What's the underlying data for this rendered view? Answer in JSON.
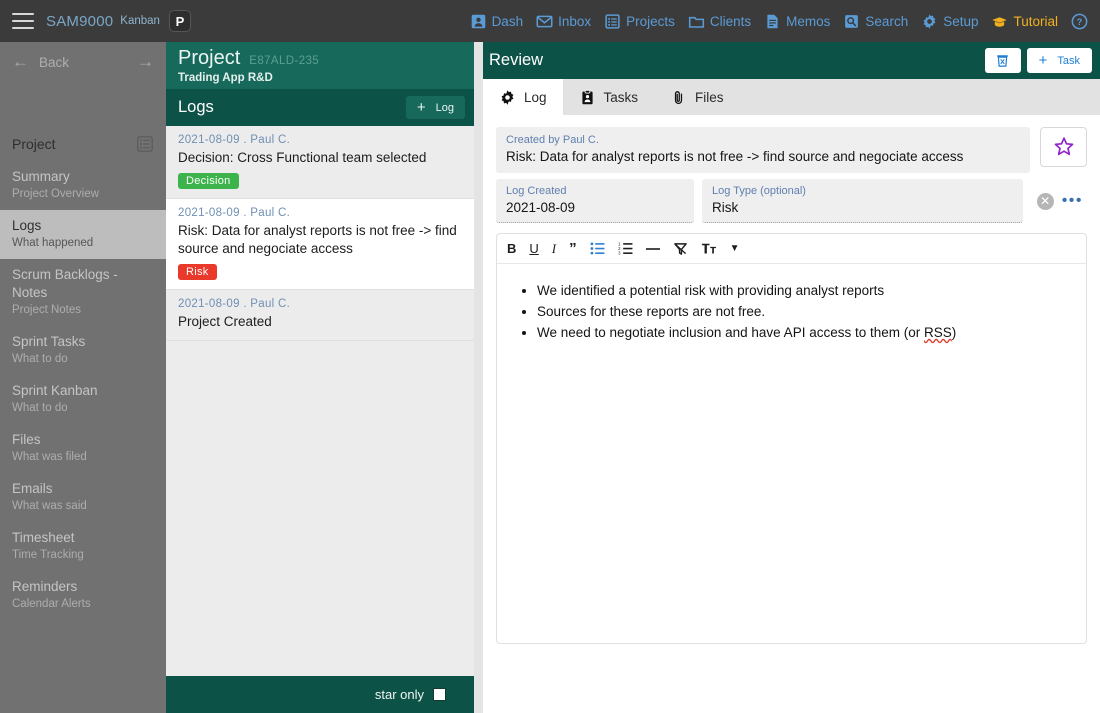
{
  "topbar": {
    "menu_icon": "hamburger-icon",
    "brand": "SAM9000",
    "brand_sub": "Kanban",
    "badge": "P",
    "nav": [
      {
        "label": "Dash",
        "icon": "user-card-icon"
      },
      {
        "label": "Inbox",
        "icon": "envelope-icon"
      },
      {
        "label": "Projects",
        "icon": "list-card-icon"
      },
      {
        "label": "Clients",
        "icon": "folder-icon"
      },
      {
        "label": "Memos",
        "icon": "document-icon"
      },
      {
        "label": "Search",
        "icon": "search-icon"
      },
      {
        "label": "Setup",
        "icon": "gear-icon"
      },
      {
        "label": "Tutorial",
        "icon": "graduation-cap-icon"
      }
    ],
    "help_icon": "question-circle-icon",
    "accent_blue": "#5b9bd5",
    "accent_yellow": "#f2b01e"
  },
  "sidebar": {
    "back_label": "Back",
    "back_icon": "arrow-left-icon",
    "forward_icon": "arrow-right-icon",
    "section_title": "Project",
    "section_icon": "list-grid-icon",
    "items": [
      {
        "label": "Summary",
        "sub": "Project Overview",
        "active": false
      },
      {
        "label": "Logs",
        "sub": "What happened",
        "active": true
      },
      {
        "label": "Scrum Backlogs - Notes",
        "sub": "Project Notes",
        "active": false
      },
      {
        "label": "Sprint Tasks",
        "sub": "What to do",
        "active": false
      },
      {
        "label": "Sprint Kanban",
        "sub": "What to do",
        "active": false
      },
      {
        "label": "Files",
        "sub": "What was filed",
        "active": false
      },
      {
        "label": "Emails",
        "sub": "What was said",
        "active": false
      },
      {
        "label": "Timesheet",
        "sub": "Time Tracking",
        "active": false
      },
      {
        "label": "Reminders",
        "sub": "Calendar Alerts",
        "active": false
      }
    ]
  },
  "project": {
    "title": "Project",
    "id": "E87ALD-235",
    "subtitle": "Trading App R&D",
    "header_color": "#17695c"
  },
  "logs": {
    "title": "Logs",
    "add_button": "Log",
    "add_icon": "plus-icon",
    "entries": [
      {
        "meta": "2021-08-09 . Paul C.",
        "title": "Decision: Cross Functional team selected",
        "tag": "Decision",
        "tag_color": "#3cb44b",
        "selected": false
      },
      {
        "meta": "2021-08-09 . Paul C.",
        "title": "Risk: Data for analyst reports is not free -> find source and negociate access",
        "tag": "Risk",
        "tag_color": "#e8392a",
        "selected": true
      },
      {
        "meta": "2021-08-09 . Paul C.",
        "title": "Project Created",
        "tag": "",
        "tag_color": "",
        "selected": false
      }
    ],
    "footer_label": "star only",
    "footer_checked": false
  },
  "review": {
    "title": "Review",
    "delete_icon": "trash-icon",
    "task_button": "Task",
    "task_icon": "plus-icon",
    "tabs": [
      {
        "label": "Log",
        "icon": "gear-icon",
        "active": true
      },
      {
        "label": "Tasks",
        "icon": "clipboard-icon",
        "active": false
      },
      {
        "label": "Files",
        "icon": "paperclip-icon",
        "active": false
      }
    ],
    "created_by_label": "Created by Paul C.",
    "log_title": "Risk: Data for analyst reports is not free -> find source and negociate access",
    "star_icon": "star-outline-icon",
    "star_color": "#8e24c9",
    "log_created_label": "Log Created",
    "log_created_value": "2021-08-09",
    "log_type_label": "Log Type (optional)",
    "log_type_value": "Risk",
    "clear_icon": "x-circle-icon",
    "more_icon": "more-dots-icon",
    "toolbar": [
      {
        "name": "bold-icon",
        "glyph": "B",
        "active": false
      },
      {
        "name": "underline-icon",
        "glyph": "U",
        "active": false
      },
      {
        "name": "italic-icon",
        "glyph": "I",
        "active": false
      },
      {
        "name": "quote-icon",
        "glyph": "”",
        "active": false
      },
      {
        "name": "bullet-list-icon",
        "glyph": "",
        "active": true
      },
      {
        "name": "numbered-list-icon",
        "glyph": "",
        "active": false
      },
      {
        "name": "horizontal-rule-icon",
        "glyph": "–",
        "active": false
      },
      {
        "name": "clear-format-icon",
        "glyph": "",
        "active": false
      },
      {
        "name": "text-size-icon",
        "glyph": "ᴛᴛ",
        "active": false
      },
      {
        "name": "chevron-down-icon",
        "glyph": "▾",
        "active": false
      }
    ],
    "body_bullets": [
      "We identified a potential risk with providing analyst reports",
      "Sources for these reports are not free.",
      "We need to negotiate inclusion and have API access to them (or RSS)"
    ]
  }
}
